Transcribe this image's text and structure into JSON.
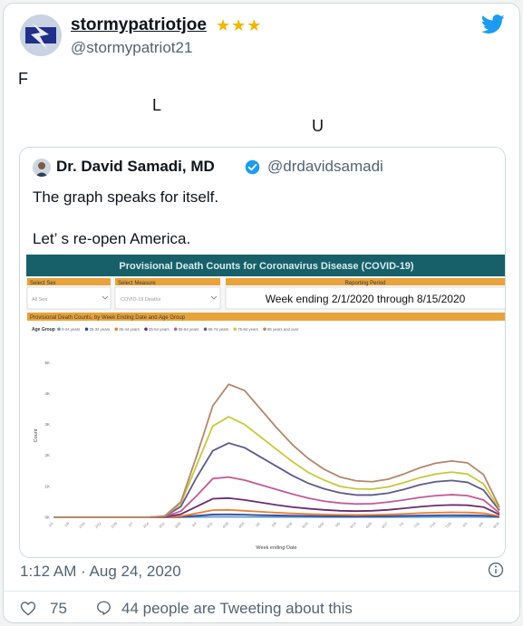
{
  "tweet": {
    "author_name": "stormypatriotjoe",
    "stars": "★★★",
    "handle": "@stormypatriot21",
    "body_letters": [
      "F",
      "L",
      "U"
    ],
    "timestamp": "1:12 AM · Aug 24, 2020",
    "likes": "75",
    "tweeting_text": "44 people are Tweeting about this"
  },
  "quoted": {
    "name": "Dr. David Samadi, MD",
    "handle": "@drdavidsamadi",
    "line1": "The graph speaks for itself.",
    "line2": "Let’ s re-open America."
  },
  "dashboard": {
    "title": "Provisional Death Counts for Coronavirus Disease (COVID-19)",
    "select_sex_label": "Select Sex",
    "select_sex_value": "All Sex",
    "select_measure_label": "Select Measure",
    "select_measure_value": "COVID-19 Deaths",
    "reporting_period_label": "Reporting Period",
    "reporting_period_value": "Week ending 2/1/2020 through 8/15/2020",
    "subtitle": "Provisional Death Counts, by Week Ending Date and Age Group",
    "legend_label": "Age Group",
    "xlabel": "Week ending Date",
    "ylabel": "Count"
  },
  "chart_data": {
    "type": "line",
    "title": "Provisional Death Counts, by Week Ending Date and Age Group",
    "xlabel": "Week ending Date",
    "ylabel": "Count",
    "y_ticks": [
      "0K",
      "1K",
      "2K",
      "3K",
      "4K",
      "5K"
    ],
    "ylim": [
      0,
      5800
    ],
    "x": [
      "2/1",
      "2/8",
      "2/15",
      "2/22",
      "2/29",
      "3/7",
      "3/14",
      "3/21",
      "3/28",
      "4/4",
      "4/11",
      "4/18",
      "4/25",
      "5/2",
      "5/9",
      "5/16",
      "5/23",
      "5/30",
      "6/6",
      "6/13",
      "6/20",
      "6/27",
      "7/4",
      "7/11",
      "7/18",
      "7/25",
      "8/1",
      "8/8",
      "8/15"
    ],
    "legend": "top-left",
    "series": [
      {
        "name": "0-24 years",
        "color": "#5b9bd5",
        "values": [
          0,
          0,
          0,
          0,
          0,
          0,
          0,
          0,
          2,
          8,
          14,
          14,
          12,
          10,
          9,
          8,
          7,
          6,
          6,
          6,
          6,
          6,
          7,
          8,
          10,
          11,
          11,
          9,
          4
        ]
      },
      {
        "name": "25-34 years",
        "color": "#2e4b9b",
        "values": [
          0,
          0,
          0,
          0,
          0,
          0,
          0,
          2,
          15,
          50,
          90,
          95,
          85,
          70,
          60,
          50,
          42,
          36,
          32,
          30,
          32,
          36,
          45,
          55,
          62,
          66,
          64,
          55,
          20
        ]
      },
      {
        "name": "35-44 years",
        "color": "#ed7d31",
        "values": [
          0,
          0,
          0,
          0,
          0,
          0,
          0,
          4,
          35,
          130,
          230,
          240,
          210,
          180,
          150,
          125,
          105,
          90,
          80,
          75,
          80,
          90,
          110,
          135,
          150,
          160,
          155,
          130,
          40
        ]
      },
      {
        "name": "45-54 years",
        "color": "#6a2c70",
        "values": [
          0,
          0,
          0,
          0,
          0,
          0,
          1,
          10,
          100,
          350,
          600,
          620,
          560,
          480,
          400,
          330,
          280,
          240,
          210,
          200,
          210,
          240,
          290,
          340,
          380,
          400,
          390,
          330,
          90
        ]
      },
      {
        "name": "55-64 years",
        "color": "#c55a95",
        "values": [
          0,
          0,
          0,
          0,
          0,
          0,
          2,
          20,
          200,
          700,
          1250,
          1300,
          1200,
          1050,
          900,
          750,
          620,
          520,
          460,
          430,
          440,
          490,
          560,
          640,
          700,
          730,
          700,
          560,
          140
        ]
      },
      {
        "name": "65-74 years",
        "color": "#5e5a8c",
        "values": [
          0,
          0,
          0,
          0,
          0,
          0,
          3,
          30,
          350,
          1300,
          2150,
          2400,
          2250,
          1950,
          1650,
          1350,
          1100,
          920,
          790,
          720,
          720,
          780,
          900,
          1050,
          1150,
          1190,
          1130,
          880,
          220
        ]
      },
      {
        "name": "75-84 years",
        "color": "#c8c83c",
        "values": [
          0,
          0,
          0,
          0,
          0,
          0,
          3,
          40,
          450,
          1700,
          2950,
          3250,
          3000,
          2600,
          2200,
          1800,
          1450,
          1200,
          1000,
          920,
          910,
          980,
          1120,
          1280,
          1400,
          1460,
          1400,
          1080,
          270
        ]
      },
      {
        "name": "85 years and over",
        "color": "#b5866b",
        "values": [
          0,
          0,
          0,
          0,
          0,
          0,
          4,
          45,
          500,
          2000,
          3600,
          4300,
          4100,
          3500,
          2900,
          2350,
          1900,
          1550,
          1300,
          1180,
          1150,
          1230,
          1400,
          1600,
          1750,
          1820,
          1760,
          1380,
          330
        ]
      }
    ]
  }
}
